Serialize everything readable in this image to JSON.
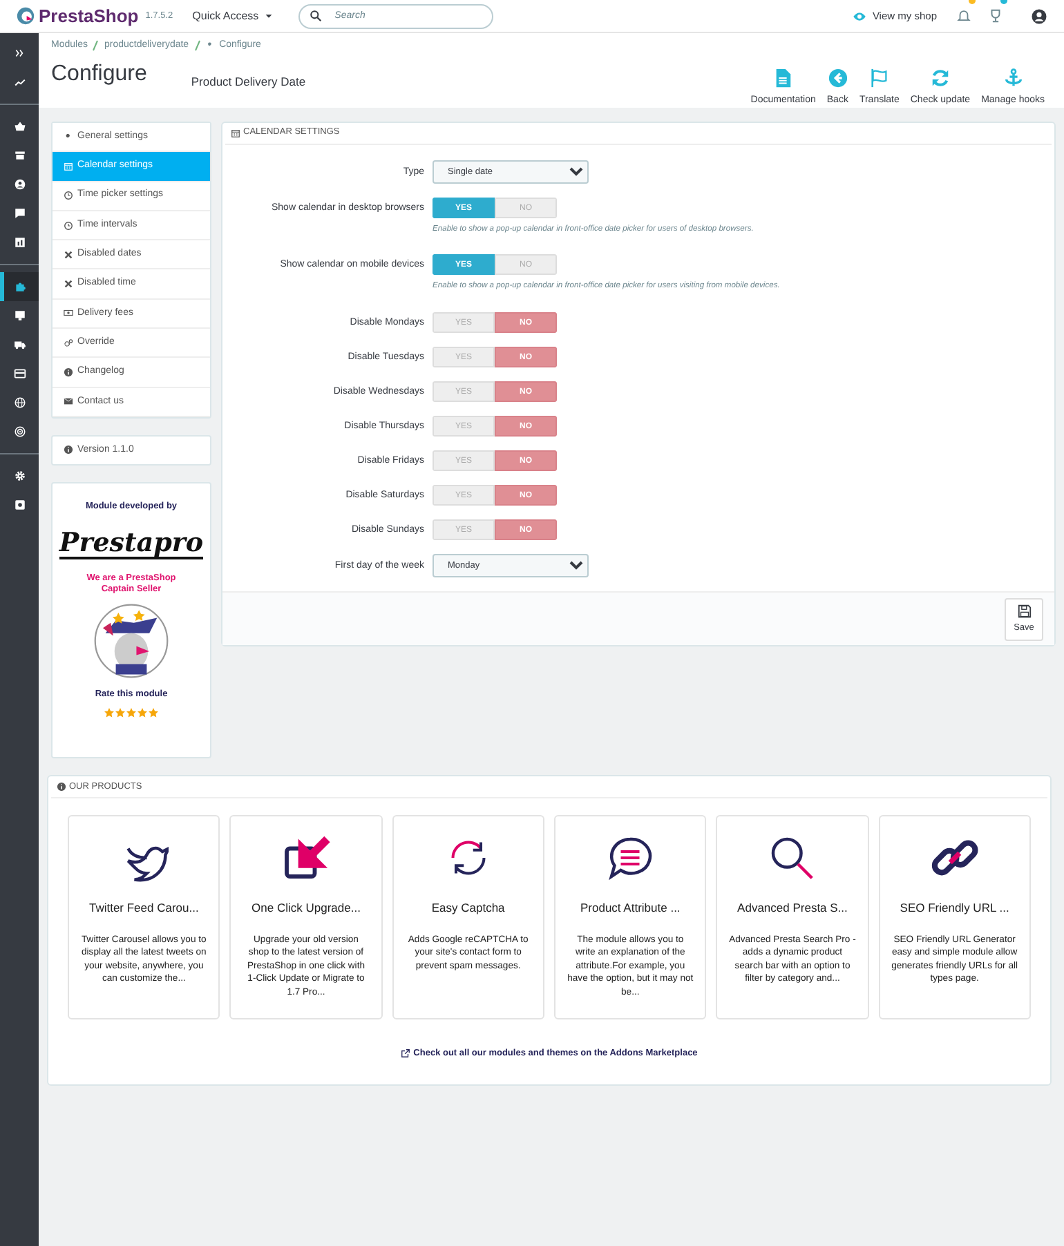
{
  "header": {
    "logo": "PrestaShop",
    "version": "1.7.5.2",
    "quick_access": "Quick Access",
    "search": {
      "placeholder": "Search"
    },
    "view_shop": "View my shop"
  },
  "nav_groups": [
    [
      {
        "selected": false
      },
      {
        "selected": false
      }
    ],
    [
      {
        "selected": false
      },
      {
        "selected": false
      },
      {
        "selected": false
      },
      {
        "selected": false
      },
      {
        "selected": false
      }
    ],
    [
      {
        "selected": true
      },
      {
        "selected": false
      },
      {
        "selected": false
      },
      {
        "selected": false
      },
      {
        "selected": false
      },
      {
        "selected": false
      }
    ],
    [
      {
        "selected": false
      },
      {
        "selected": false
      }
    ]
  ],
  "breadcrumb": [
    "Modules",
    "productdeliverydate",
    "Configure"
  ],
  "title": "Configure",
  "subtitle": "Product Delivery Date",
  "toolbar": [
    "Documentation",
    "Back",
    "Translate",
    "Check update",
    "Manage hooks"
  ],
  "menu": [
    {
      "label": "General settings",
      "selected": false
    },
    {
      "label": "Calendar settings",
      "selected": true
    },
    {
      "label": "Time picker settings",
      "selected": false
    },
    {
      "label": "Time intervals",
      "selected": false
    },
    {
      "label": "Disabled dates",
      "selected": false
    },
    {
      "label": "Disabled time",
      "selected": false
    },
    {
      "label": "Delivery fees",
      "selected": false
    },
    {
      "label": "Override",
      "selected": false
    },
    {
      "label": "Changelog",
      "selected": false
    },
    {
      "label": "Contact us",
      "selected": false
    }
  ],
  "version": "Version 1.1.0",
  "promo": {
    "developed_by": "Module developed by",
    "brand": "Prestapro",
    "captain": "We are a PrestaShop Captain Seller",
    "rate": "Rate this module",
    "stars": 5
  },
  "panel": {
    "title": "CALENDAR SETTINGS",
    "fields": [
      {
        "kind": "select",
        "label": "Type",
        "value": "Single date"
      },
      {
        "kind": "switch",
        "label": "Show calendar in desktop browsers",
        "on": true,
        "yes": "YES",
        "no": "NO",
        "help": "Enable to show a pop-up calendar in front-office date picker for users of desktop browsers."
      },
      {
        "kind": "switch",
        "label": "Show calendar on mobile devices",
        "on": true,
        "yes": "YES",
        "no": "NO",
        "help": "Enable to show a pop-up calendar in front-office date picker for users visiting from mobile devices."
      },
      {
        "kind": "switch",
        "label": "Disable Mondays",
        "on": false,
        "yes": "YES",
        "no": "NO"
      },
      {
        "kind": "switch",
        "label": "Disable Tuesdays",
        "on": false,
        "yes": "YES",
        "no": "NO"
      },
      {
        "kind": "switch",
        "label": "Disable Wednesdays",
        "on": false,
        "yes": "YES",
        "no": "NO"
      },
      {
        "kind": "switch",
        "label": "Disable Thursdays",
        "on": false,
        "yes": "YES",
        "no": "NO"
      },
      {
        "kind": "switch",
        "label": "Disable Fridays",
        "on": false,
        "yes": "YES",
        "no": "NO"
      },
      {
        "kind": "switch",
        "label": "Disable Saturdays",
        "on": false,
        "yes": "YES",
        "no": "NO"
      },
      {
        "kind": "switch",
        "label": "Disable Sundays",
        "on": false,
        "yes": "YES",
        "no": "NO"
      },
      {
        "kind": "select",
        "label": "First day of the week",
        "value": "Monday"
      }
    ],
    "save": "Save"
  },
  "products": {
    "title": "OUR PRODUCTS",
    "items": [
      {
        "name": "Twitter Feed Carou...",
        "description": "Twitter Carousel allows you to display all the latest tweets on your website, anywhere, you can customize the..."
      },
      {
        "name": "One Click Upgrade...",
        "description": "Upgrade your old version shop to the latest version of PrestaShop in one click with 1-Click Update or Migrate to 1.7 Pro..."
      },
      {
        "name": "Easy Captcha",
        "description": "Adds Google reCAPTCHA to your site's contact form to prevent spam messages."
      },
      {
        "name": "Product Attribute ...",
        "description": "The module allows you to write an explanation of the attribute.For example, you have the option, but it may not be..."
      },
      {
        "name": "Advanced Presta S...",
        "description": "Advanced Presta Search Pro - adds a dynamic product search bar with an option to filter by category and..."
      },
      {
        "name": "SEO Friendly URL ...",
        "description": "SEO Friendly URL Generator easy and simple module allow generates friendly URLs for all types page."
      }
    ],
    "link": "Check out all our modules and themes on the Addons Marketplace"
  }
}
